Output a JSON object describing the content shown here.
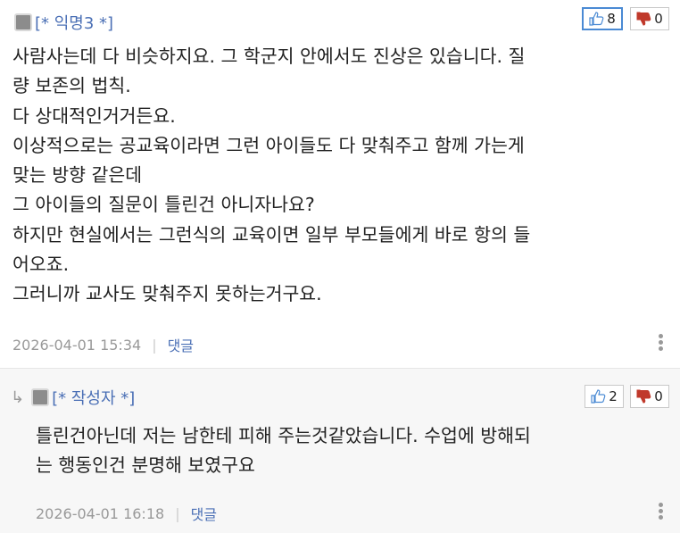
{
  "comments": [
    {
      "nickname": "[* 익명3 *]",
      "likes": "8",
      "dislikes": "0",
      "body": "사람사는데 다 비슷하지요. 그 학군지 안에서도 진상은 있습니다. 질\n량 보존의 법칙.\n다 상대적인거거든요.\n이상적으로는 공교육이라면 그런 아이들도 다 맞춰주고 함께 가는게\n맞는 방향 같은데\n그 아이들의 질문이 틀린건 아니자나요?\n하지만 현실에서는 그런식의 교육이면 일부 부모들에게 바로 항의 들\n어오죠.\n그러니까 교사도 맞춰주지 못하는거구요.",
      "date": "2026-04-01 15:34",
      "reply_label": "댓글"
    },
    {
      "nickname": "[* 작성자 *]",
      "likes": "2",
      "dislikes": "0",
      "body": "틀린건아닌데 저는 남한테 피해 주는것같았습니다. 수업에 방해되\n는 행동인건 분명해 보였구요",
      "date": "2026-04-01 16:18",
      "reply_label": "댓글"
    }
  ],
  "icons": {
    "thumb_up": "thumb-up-icon",
    "thumb_down": "thumb-down-icon",
    "reply": "reply-arrow-icon",
    "more": "more-vertical-icon"
  },
  "colors": {
    "nickname": "#4a6fb5",
    "like_border_active": "#4a8ad4",
    "dislike_icon": "#c0392b",
    "meta_date": "#999999",
    "reply_bg": "#f7f7f7"
  }
}
